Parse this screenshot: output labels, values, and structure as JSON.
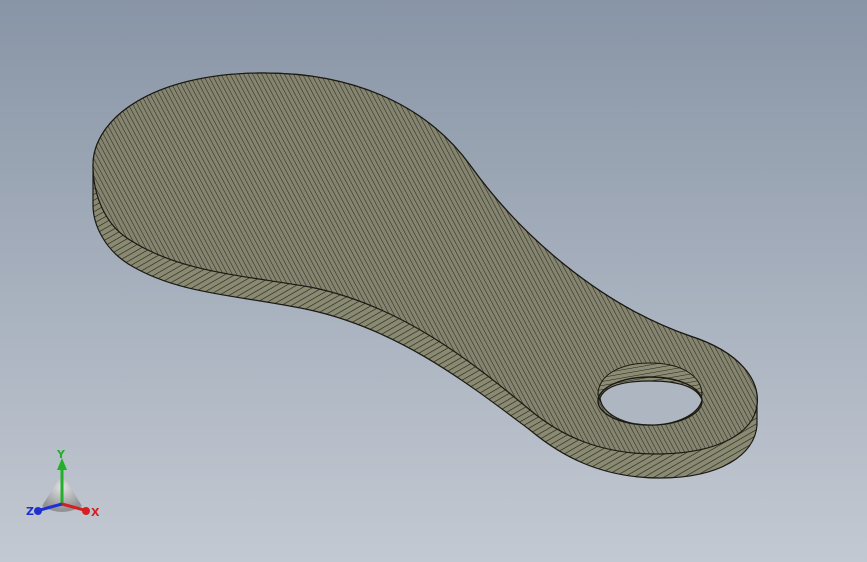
{
  "viewport": {
    "background_top": "#8895a6",
    "background_bottom": "#c3c9d2",
    "model_face_color": "#7e7d6a",
    "model_edge_color": "#1a1a14",
    "display_mode": "shaded-with-edges"
  },
  "triad": {
    "x_label": "X",
    "y_label": "Y",
    "z_label": "Z",
    "x_color": "#d42020",
    "y_color": "#22b02a",
    "z_color": "#2030d0"
  }
}
